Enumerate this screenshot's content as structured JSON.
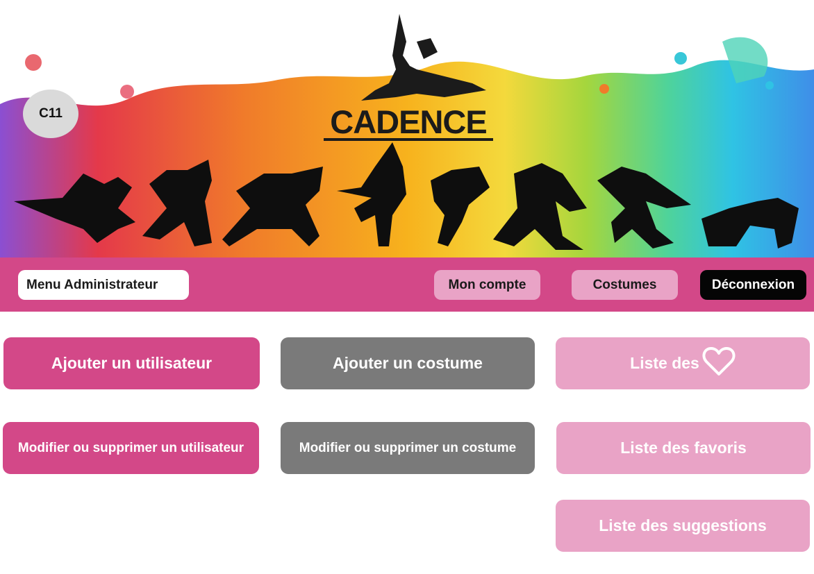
{
  "banner": {
    "badge": "C11",
    "logo_text": "CADENCE",
    "colors": [
      "#e4394a",
      "#f07b2a",
      "#f7b21d",
      "#f4d93c",
      "#a5d63d",
      "#4fd39a",
      "#2fc3e4",
      "#3f8ee8",
      "#8b4fd2"
    ]
  },
  "nav": {
    "menu_title": "Menu Administrateur",
    "account": "Mon compte",
    "costumes": "Costumes",
    "logout": "Déconnexion"
  },
  "actions": {
    "add_user": "Ajouter un utilisateur",
    "edit_user": "Modifier ou supprimer un utilisateur",
    "add_costume": "Ajouter un costume",
    "edit_costume": "Modifier ou supprimer un costume",
    "wish_list": "Liste des",
    "wish_icon": "heart-icon",
    "favorites": "Liste des favoris",
    "suggestions": "Liste des suggestions"
  },
  "theme": {
    "pink": "#d34888",
    "grey": "#7a7a7a",
    "light_pink": "#e9a3c6",
    "black": "#050505"
  }
}
